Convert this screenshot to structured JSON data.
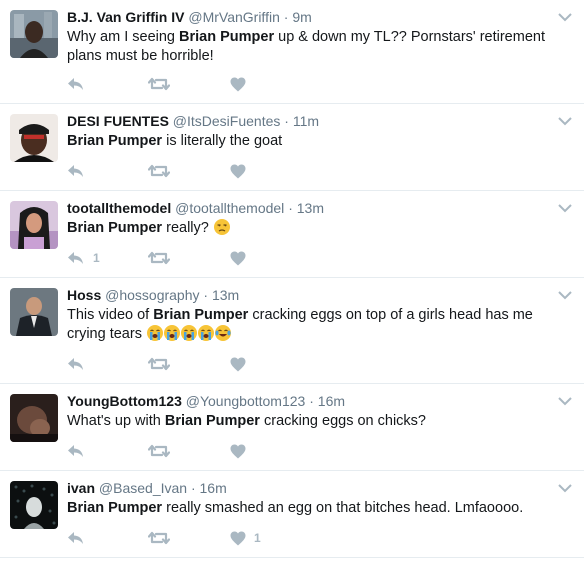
{
  "tweets": [
    {
      "name": "B.J. Van Griffin IV",
      "handle": "@MrVanGriffin",
      "sep": "·",
      "time": "9m",
      "text_before": "Why am I seeing ",
      "highlight": "Brian Pumper",
      "text_after": " up & down my TL?? Pornstars' retirement plans must be horrible!",
      "reply_count": "",
      "like_count": "",
      "emojis": []
    },
    {
      "name": "DESI FUENTES",
      "handle": "@ItsDesiFuentes",
      "sep": "·",
      "time": "11m",
      "text_before": "",
      "highlight": "Brian Pumper",
      "text_after": " is literally the goat",
      "reply_count": "",
      "like_count": "",
      "emojis": []
    },
    {
      "name": "tootallthemodel",
      "handle": "@tootallthemodel",
      "sep": "·",
      "time": "13m",
      "text_before": "",
      "highlight": "Brian Pumper",
      "text_after": " really?",
      "reply_count": "1",
      "like_count": "",
      "emojis": [
        "unamused-face"
      ]
    },
    {
      "name": "Hoss",
      "handle": "@hossography",
      "sep": "·",
      "time": "13m",
      "text_before": "This video of ",
      "highlight": "Brian Pumper",
      "text_after": " cracking eggs on top of a girls head has me crying tears",
      "reply_count": "",
      "like_count": "",
      "emojis": [
        "loudly-crying-face",
        "loudly-crying-face",
        "loudly-crying-face",
        "loudly-crying-face",
        "tears-of-joy-face"
      ]
    },
    {
      "name": "YoungBottom123",
      "handle": "@Youngbottom123",
      "sep": "·",
      "time": "16m",
      "text_before": "What's up with ",
      "highlight": "Brian Pumper",
      "text_after": " cracking eggs on chicks?",
      "reply_count": "",
      "like_count": "",
      "emojis": []
    },
    {
      "name": "ivan",
      "handle": "@Based_Ivan",
      "sep": "·",
      "time": "16m",
      "text_before": "",
      "highlight": "Brian Pumper",
      "text_after": " really smashed an egg on that bitches head. Lmfaoooo.",
      "reply_count": "",
      "like_count": "1",
      "emojis": []
    }
  ],
  "colors": {
    "secondary_text": "#657786",
    "action_icon": "#aab8c2",
    "divider": "#e6ecf0"
  },
  "icons": {
    "reply": "reply-icon",
    "retweet": "retweet-icon",
    "like": "heart-icon",
    "menu": "chevron-down-icon"
  }
}
